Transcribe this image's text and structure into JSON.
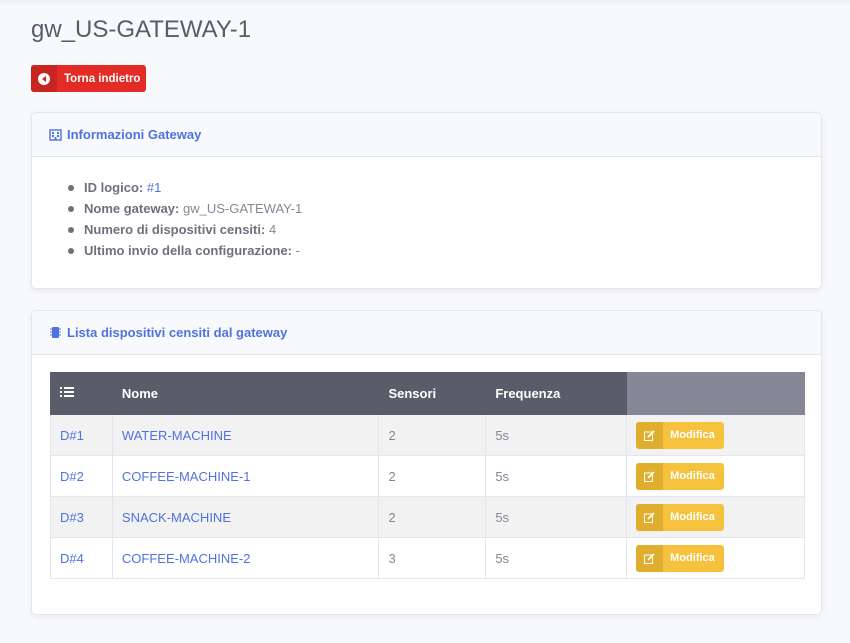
{
  "page": {
    "title": "gw_US-GATEWAY-1"
  },
  "back_button": {
    "label": "Torna indietro",
    "icon": "arrow-circle-left-icon"
  },
  "info_card": {
    "title": "Informazioni Gateway",
    "icon": "building-icon",
    "items": [
      {
        "label": "ID logico:",
        "value": "#1"
      },
      {
        "label": "Nome gateway:",
        "value": "gw_US-GATEWAY-1"
      },
      {
        "label": "Numero di dispositivi censiti:",
        "value": "4"
      },
      {
        "label": "Ultimo invio della configurazione:",
        "value": "-"
      }
    ]
  },
  "devices_card": {
    "title": "Lista dispositivi censiti dal gateway",
    "icon": "microchip-icon",
    "columns": [
      "",
      "Nome",
      "Sensori",
      "Frequenza",
      ""
    ],
    "header_icon": "list-icon",
    "rows": [
      {
        "id": "D#1",
        "name": "WATER-MACHINE",
        "sensors": "2",
        "freq": "5s",
        "action": "Modifica"
      },
      {
        "id": "D#2",
        "name": "COFFEE-MACHINE-1",
        "sensors": "2",
        "freq": "5s",
        "action": "Modifica"
      },
      {
        "id": "D#3",
        "name": "SNACK-MACHINE",
        "sensors": "2",
        "freq": "5s",
        "action": "Modifica"
      },
      {
        "id": "D#4",
        "name": "COFFEE-MACHINE-2",
        "sensors": "3",
        "freq": "5s",
        "action": "Modifica"
      }
    ]
  },
  "colors": {
    "primary": "#4e73df",
    "danger": "#e52b26",
    "warning": "#f6c23e",
    "table_head": "#5a5c69"
  }
}
